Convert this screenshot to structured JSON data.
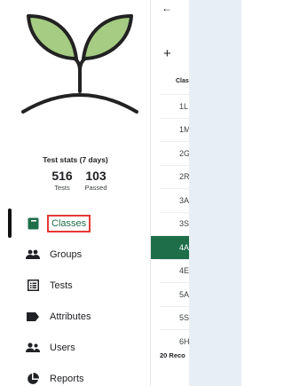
{
  "stats": {
    "title": "Test stats (7 days)",
    "tests_value": "516",
    "tests_label": "Tests",
    "passed_value": "103",
    "passed_label": "Passed"
  },
  "nav": {
    "classes": "Classes",
    "groups": "Groups",
    "tests": "Tests",
    "attributes": "Attributes",
    "users": "Users",
    "reports": "Reports"
  },
  "content": {
    "back_icon": "←",
    "add_icon": "+",
    "column_header": "Clas",
    "rows": [
      "1L",
      "1M",
      "2G",
      "2R",
      "3A",
      "3S",
      "4A",
      "4E",
      "5A",
      "5S",
      "6H"
    ],
    "selected_row": "4A",
    "footer": "20 Reco"
  },
  "colors": {
    "accent": "#1e6e4a",
    "highlight_box": "#e53935",
    "side_panel": "#e8eef5"
  }
}
